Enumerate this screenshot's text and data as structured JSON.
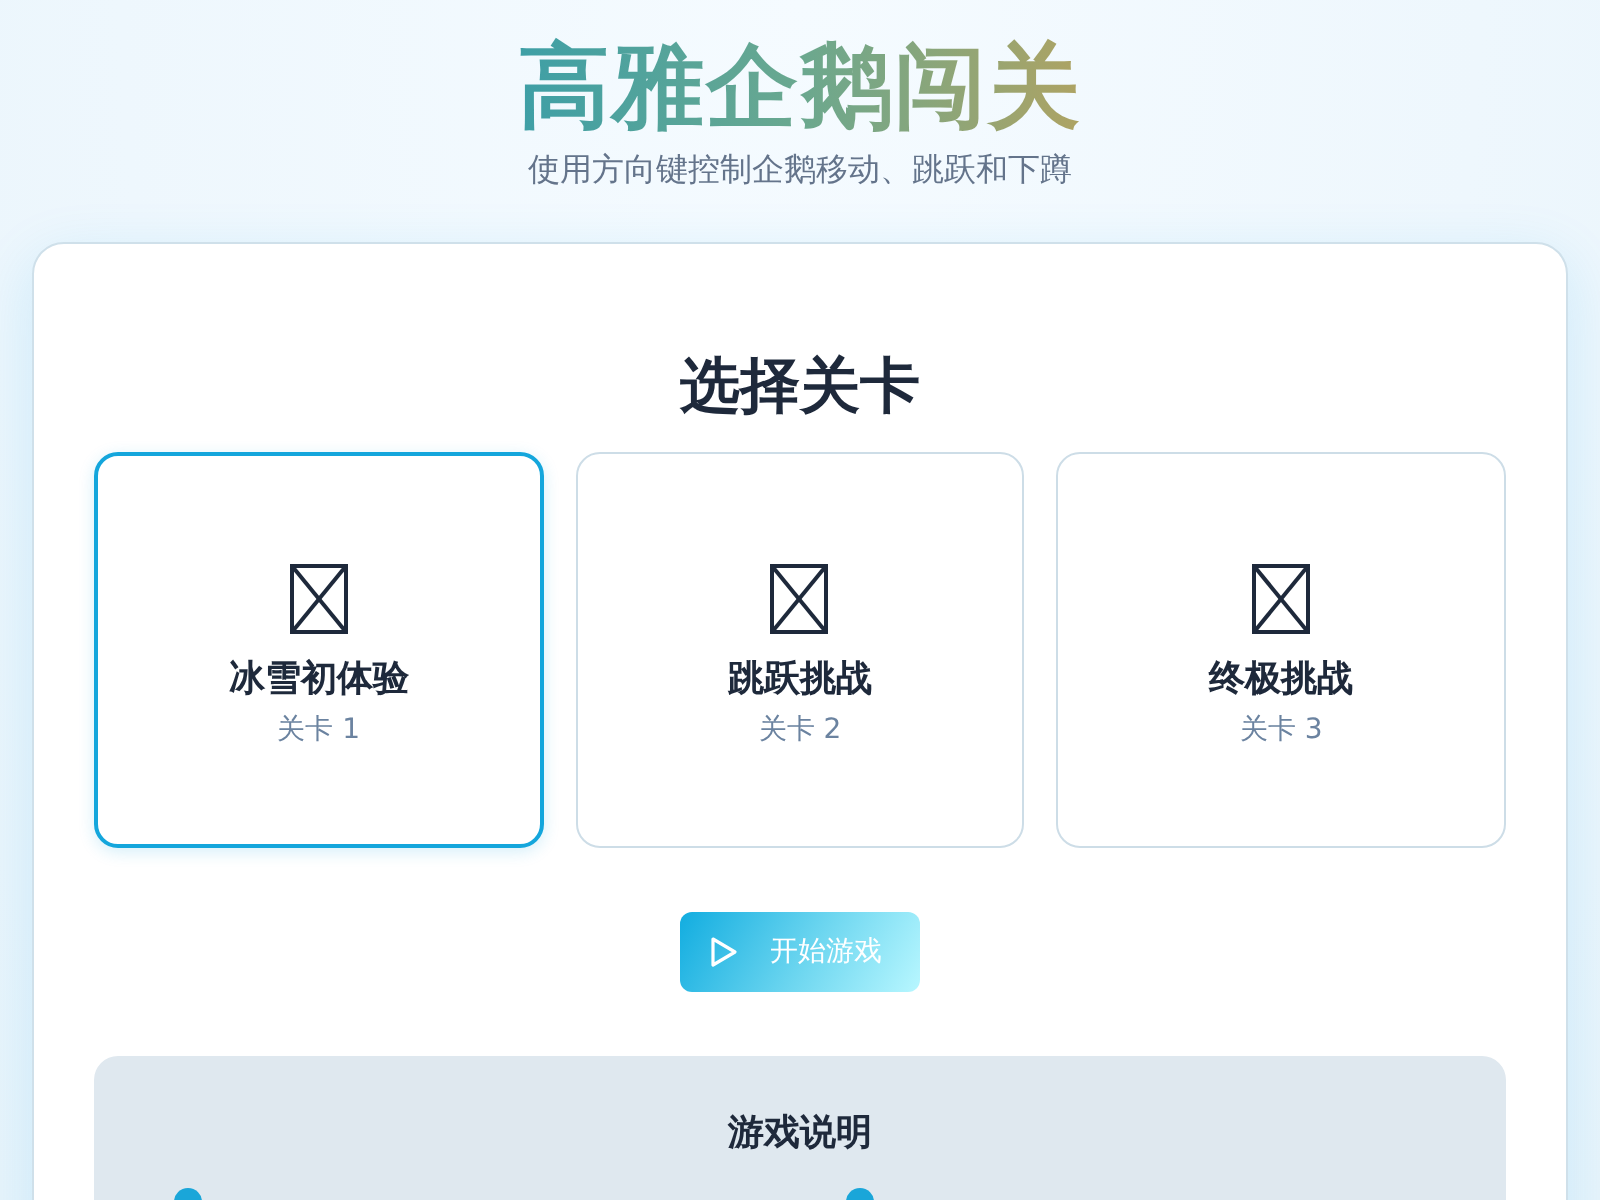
{
  "header": {
    "title": "高雅企鹅闯关",
    "subtitle": "使用方向键控制企鹅移动、跳跃和下蹲"
  },
  "level_select": {
    "heading": "选择关卡",
    "levels": [
      {
        "name": "冰雪初体验",
        "label": "关卡 1",
        "selected": true
      },
      {
        "name": "跳跃挑战",
        "label": "关卡 2",
        "selected": false
      },
      {
        "name": "终极挑战",
        "label": "关卡 3",
        "selected": false
      }
    ]
  },
  "start_button": {
    "label": "开始游戏"
  },
  "instructions": {
    "heading": "游戏说明"
  }
}
